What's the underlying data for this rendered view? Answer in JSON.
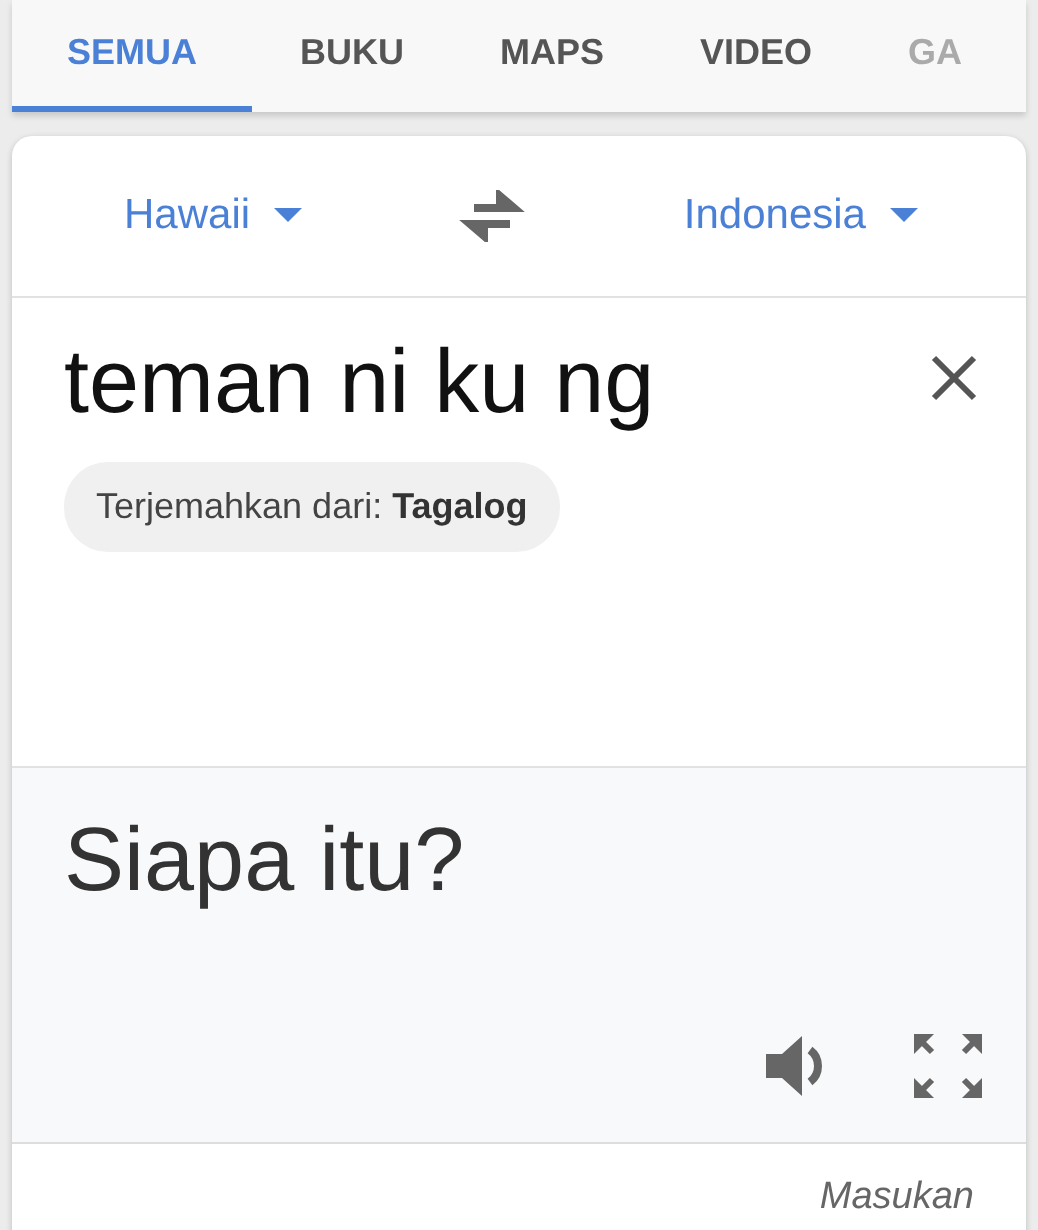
{
  "tabs": [
    {
      "label": "SEMUA",
      "selected": true
    },
    {
      "label": "BUKU",
      "selected": false
    },
    {
      "label": "MAPS",
      "selected": false
    },
    {
      "label": "VIDEO",
      "selected": false
    },
    {
      "label": "GA",
      "selected": false
    }
  ],
  "translator": {
    "source_language": "Hawaii",
    "target_language": "Indonesia",
    "source_text": "teman ni ku ng",
    "detected_label": "Terjemahkan dari:",
    "detected_language": "Tagalog",
    "result_text": "Siapa itu?",
    "feedback_link": "Masukan"
  }
}
